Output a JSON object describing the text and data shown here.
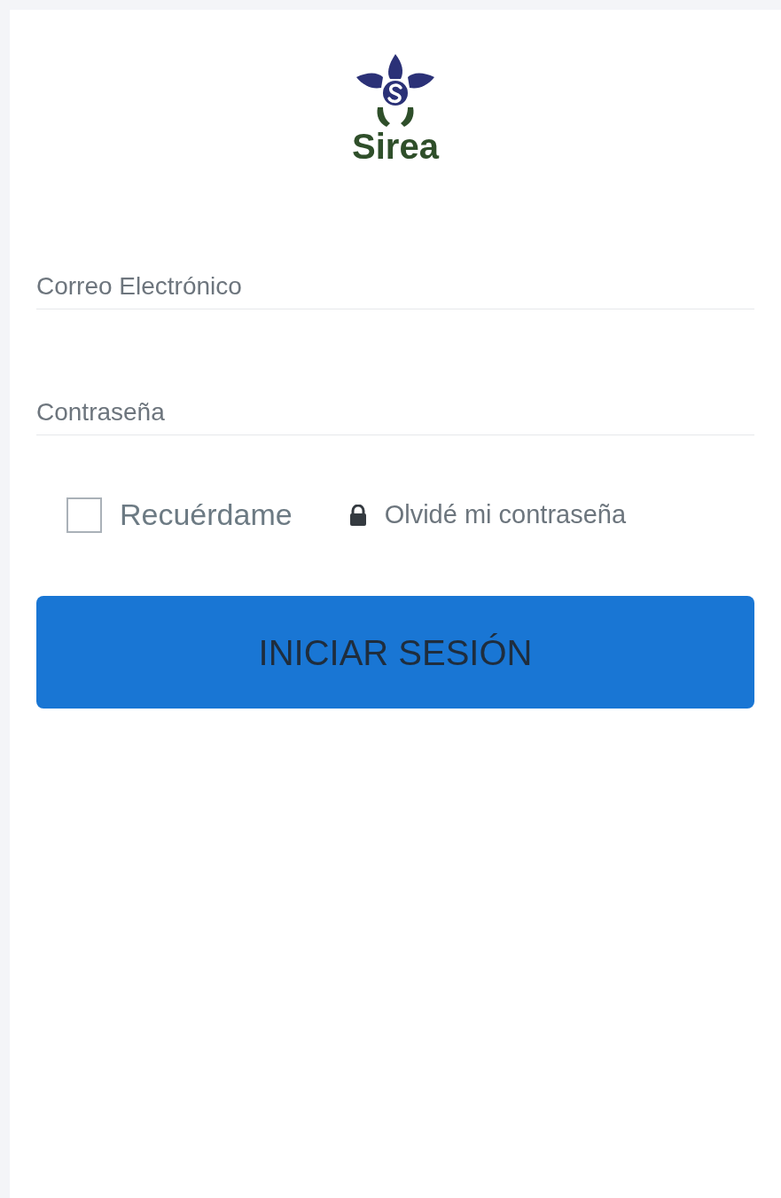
{
  "logo": {
    "text": "Sirea"
  },
  "email": {
    "placeholder": "Correo Electrónico"
  },
  "password": {
    "placeholder": "Contraseña"
  },
  "remember": {
    "label": "Recuérdame",
    "checked": false
  },
  "forgot": {
    "label": "Olvidé mi contraseña"
  },
  "submit": {
    "label": "INICIAR SESIÓN"
  }
}
